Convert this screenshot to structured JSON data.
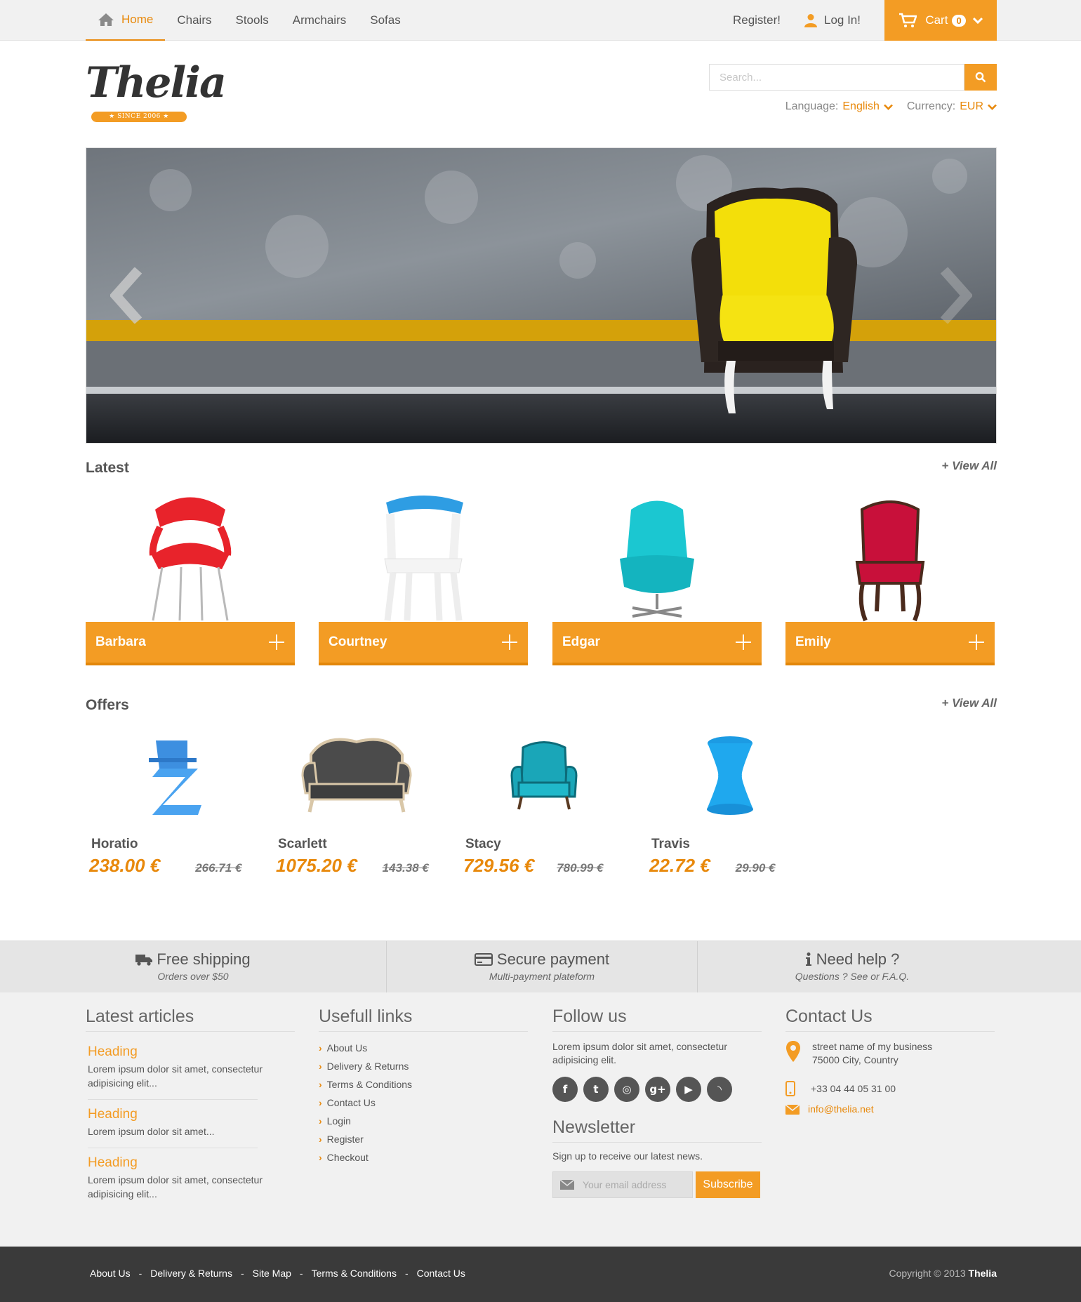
{
  "topnav": {
    "items": [
      "Home",
      "Chairs",
      "Stools",
      "Armchairs",
      "Sofas"
    ],
    "register": "Register!",
    "login": "Log In!",
    "cart_label": "Cart",
    "cart_count": "0"
  },
  "header": {
    "logo_text": "Thelia",
    "logo_since": "★  SINCE 2006  ★",
    "search_placeholder": "Search...",
    "language_label": "Language:",
    "language_value": "English",
    "currency_label": "Currency:",
    "currency_value": "EUR"
  },
  "latest": {
    "title": "Latest",
    "view_all": "+ View All",
    "products": [
      "Barbara",
      "Courtney",
      "Edgar",
      "Emily"
    ]
  },
  "offers": {
    "title": "Offers",
    "view_all": "+ View All",
    "products": [
      {
        "name": "Horatio",
        "price": "238.00 €",
        "old_price": "266.71 €"
      },
      {
        "name": "Scarlett",
        "price": "1075.20 €",
        "old_price": "143.38 €"
      },
      {
        "name": "Stacy",
        "price": "729.56 €",
        "old_price": "780.99 €"
      },
      {
        "name": "Travis",
        "price": "22.72 €",
        "old_price": "29.90 €"
      }
    ]
  },
  "reassurance": [
    {
      "title": "Free shipping",
      "subtitle": "Orders over $50"
    },
    {
      "title": "Secure payment",
      "subtitle": "Multi-payment plateform"
    },
    {
      "title": "Need help ?",
      "subtitle": "Questions ? See or F.A.Q."
    }
  ],
  "footer": {
    "articles_title": "Latest articles",
    "articles": [
      {
        "heading": "Heading",
        "text": "Lorem ipsum dolor sit amet, consectetur adipisicing elit..."
      },
      {
        "heading": "Heading",
        "text": "Lorem ipsum dolor sit amet..."
      },
      {
        "heading": "Heading",
        "text": "Lorem ipsum dolor sit amet, consectetur adipisicing elit..."
      }
    ],
    "links_title": "Usefull links",
    "links": [
      "About Us",
      "Delivery & Returns",
      "Terms & Conditions",
      "Contact Us",
      "Login",
      "Register",
      "Checkout"
    ],
    "follow_title": "Follow us",
    "follow_text": "Lorem ipsum dolor sit amet, consectetur adipisicing elit.",
    "newsletter_title": "Newsletter",
    "newsletter_text": "Sign up to receive our latest news.",
    "newsletter_placeholder": "Your email address",
    "subscribe": "Subscribe",
    "contact_title": "Contact Us",
    "address_line1": "street name of my business",
    "address_line2": "75000 City, Country",
    "phone": "+33 04 44 05 31 00",
    "email": "info@thelia.net"
  },
  "bottom": {
    "links": [
      "About Us",
      "Delivery & Returns",
      "Site Map",
      "Terms & Conditions",
      "Contact Us"
    ],
    "copyright": "Copyright © 2013",
    "brand": "Thelia"
  },
  "colors": {
    "accent": "#f39c24",
    "accent_dark": "#e8890c",
    "footer_dark": "#3a3a3a"
  },
  "icons": [
    "home-icon",
    "user-icon",
    "cart-icon",
    "search-icon",
    "truck-icon",
    "credit-card-icon",
    "info-icon",
    "map-marker-icon",
    "phone-icon",
    "envelope-icon"
  ]
}
